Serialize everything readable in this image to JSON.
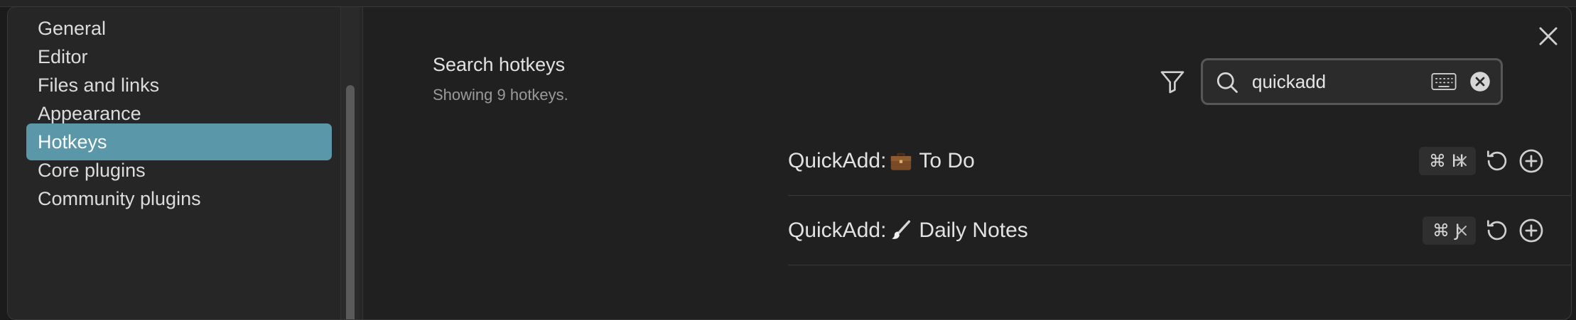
{
  "sidebar": {
    "items": [
      {
        "label": "General",
        "active": false
      },
      {
        "label": "Editor",
        "active": false
      },
      {
        "label": "Files and links",
        "active": false
      },
      {
        "label": "Appearance",
        "active": false
      },
      {
        "label": "Hotkeys",
        "active": true
      },
      {
        "label": "Core plugins",
        "active": false
      },
      {
        "label": "Community plugins",
        "active": false
      }
    ]
  },
  "search": {
    "title": "Search hotkeys",
    "subtitle": "Showing 9 hotkeys.",
    "value": "quickadd",
    "icons": [
      "filter-icon",
      "search-icon",
      "keyboard-icon",
      "clear-icon"
    ]
  },
  "hotkeys": [
    {
      "command_prefix": "QuickAdd:",
      "emoji": "briefcase-icon",
      "command_name": "To Do",
      "keys": "⌘ H"
    },
    {
      "command_prefix": "QuickAdd:",
      "emoji": "paintbrush-icon",
      "command_name": "Daily Notes",
      "keys": "⌘ J"
    }
  ],
  "colors": {
    "accent": "#5a97a8",
    "background": "#202020",
    "sidebar": "#262626"
  }
}
